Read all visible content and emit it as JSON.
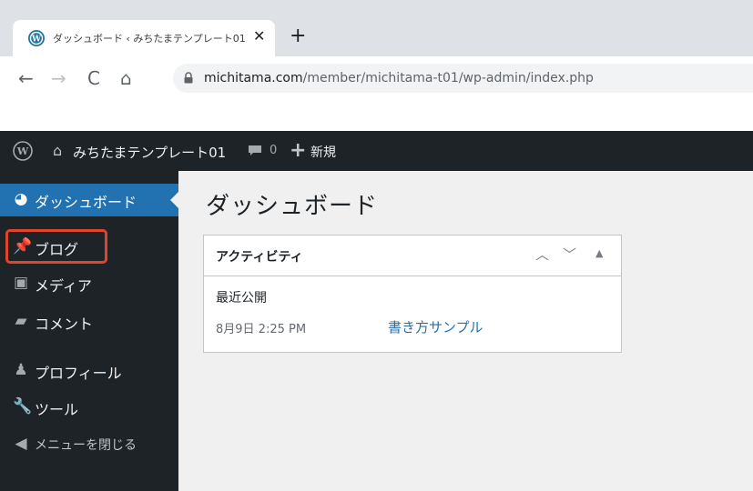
{
  "browser": {
    "tab_title": "ダッシュボード ‹ みちたまテンプレート01",
    "tab_close": "✕",
    "new_tab": "+",
    "url_host": "michitama.com",
    "url_path": "/member/michitama-t01/wp-admin/index.php"
  },
  "adminbar": {
    "site_name": "みちたまテンプレート01",
    "comment_count": "0",
    "new_label": "新規"
  },
  "sidebar": {
    "items": [
      {
        "label": "ダッシュボード",
        "icon": "dashboard-icon"
      },
      {
        "label": "ブログ",
        "icon": "pin-icon"
      },
      {
        "label": "メディア",
        "icon": "media-icon"
      },
      {
        "label": "コメント",
        "icon": "comment-icon"
      },
      {
        "label": "プロフィール",
        "icon": "user-icon"
      },
      {
        "label": "ツール",
        "icon": "wrench-icon"
      },
      {
        "label": "メニューを閉じる",
        "icon": "collapse-icon"
      }
    ]
  },
  "main": {
    "page_title": "ダッシュボード",
    "widget": {
      "title": "アクティビティ",
      "subheading": "最近公開",
      "date": "8月9日 2:25 PM",
      "link": "書き方サンプル"
    }
  },
  "colors": {
    "admin_dark": "#1d2327",
    "accent_blue": "#2271b1",
    "highlight_red": "#e0452a",
    "content_bg": "#f0f0f1"
  }
}
